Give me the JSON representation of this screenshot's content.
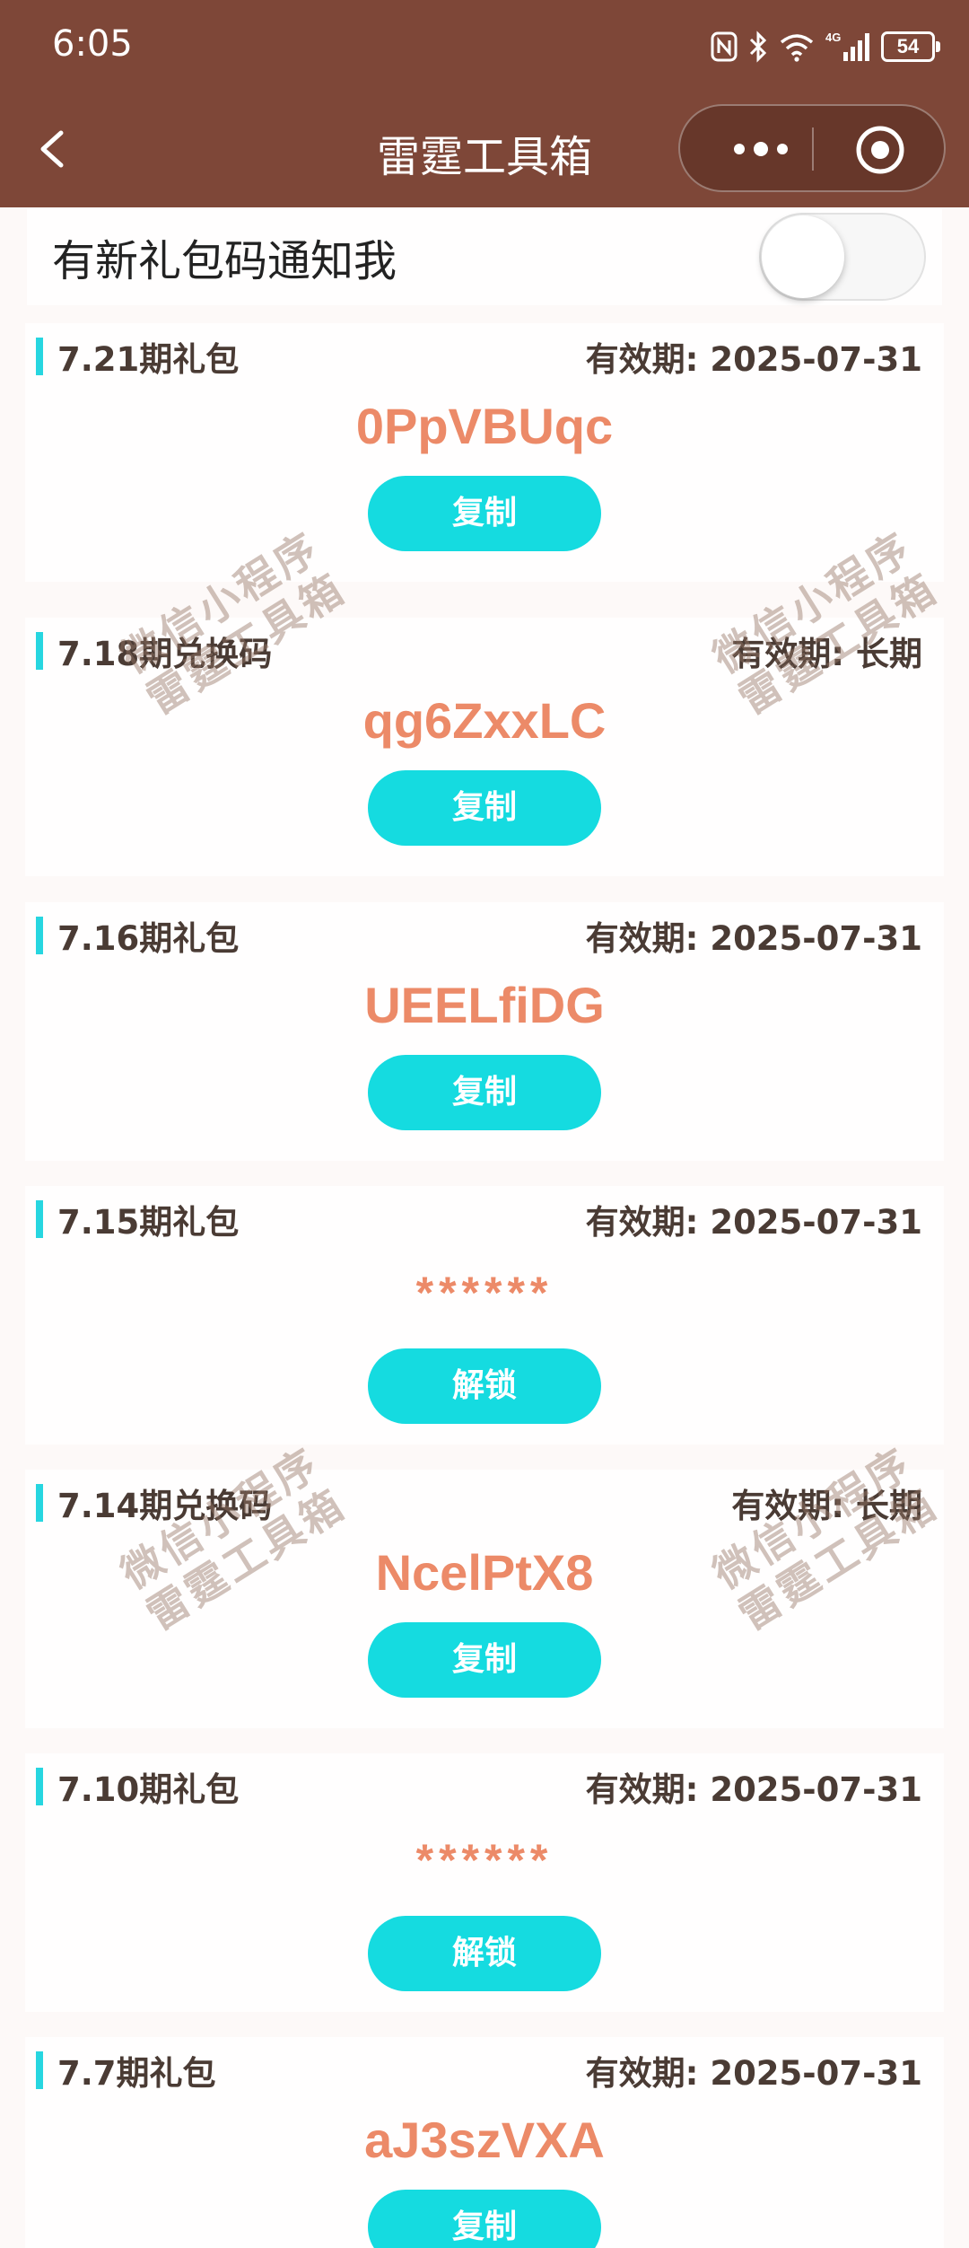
{
  "status_bar": {
    "time": "6:05",
    "network": "4G",
    "battery": "54"
  },
  "nav": {
    "title": "雷霆工具箱"
  },
  "notify": {
    "label": "有新礼包码通知我",
    "enabled": false
  },
  "watermark": {
    "line1": "微信小程序",
    "line2": "雷霆工具箱"
  },
  "cards": [
    {
      "title": "7.21期礼包",
      "expiry": "有效期: 2025-07-31",
      "code": "0PpVBUqc",
      "button": "复制"
    },
    {
      "title": "7.18期兑换码",
      "expiry": "有效期: 长期",
      "code": "qg6ZxxLC",
      "button": "复制"
    },
    {
      "title": "7.16期礼包",
      "expiry": "有效期: 2025-07-31",
      "code": "UEELfiDG",
      "button": "复制"
    },
    {
      "title": "7.15期礼包",
      "expiry": "有效期: 2025-07-31",
      "code": "******",
      "button": "解锁"
    },
    {
      "title": "7.14期兑换码",
      "expiry": "有效期: 长期",
      "code": "NcelPtX8",
      "button": "复制"
    },
    {
      "title": "7.10期礼包",
      "expiry": "有效期: 2025-07-31",
      "code": "******",
      "button": "解锁"
    },
    {
      "title": "7.7期礼包",
      "expiry": "有效期: 2025-07-31",
      "code": "aJ3szVXA",
      "button": "复制"
    }
  ]
}
